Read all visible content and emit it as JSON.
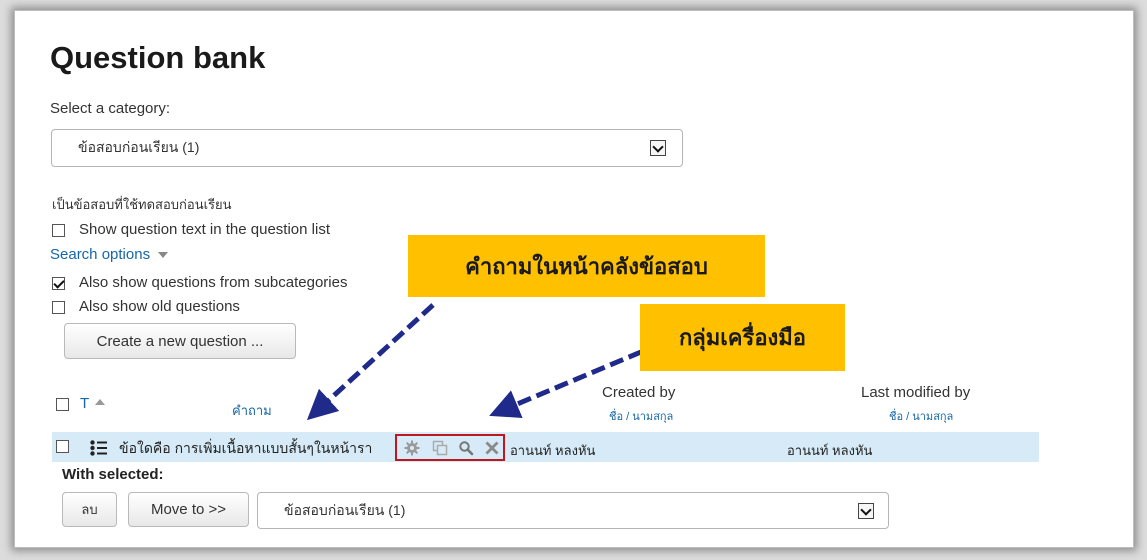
{
  "page": {
    "title": "Question bank",
    "select_category_label": "Select a category:",
    "category_selected": "ข้อสอบก่อนเรียน (1)",
    "category_info": "เป็นข้อสอบที่ใช้ทดสอบก่อนเรียน",
    "show_question_text_label": "Show question text in the question list",
    "search_options_label": "Search options",
    "subcategories_label": "Also show questions from subcategories",
    "old_questions_label": "Also show old questions",
    "create_button": "Create a new question ...",
    "show_question_text_checked": false,
    "subcategories_checked": true,
    "old_questions_checked": false
  },
  "table": {
    "type_header": "T",
    "question_header": "คำถาม",
    "created_by_header": "Created by",
    "created_by_sub": "ชื่อ / นามสกุล",
    "modified_by_header": "Last modified by",
    "modified_by_sub": "ชื่อ / นามสกุล",
    "rows": [
      {
        "question": "ข้อใดคือ การเพิ่มเนื้อหาแบบสั้นๆในหน้ารา",
        "created_by": "อานนท์ หลงหัน",
        "modified_by": "อานนท์ หลงหัน"
      }
    ]
  },
  "bulk": {
    "with_selected_label": "With selected:",
    "delete_button": "ลบ",
    "move_button": "Move to >>",
    "move_target": "ข้อสอบก่อนเรียน (1)"
  },
  "annotations": {
    "callout_question": "คำถามในหน้าคลังข้อสอบ",
    "callout_tools": "กลุ่มเครื่องมือ"
  },
  "colors": {
    "callout": "#ffc000",
    "arrow": "#1f2a8a",
    "highlight_box": "#c0161d",
    "row_bg": "#d6ebf7",
    "link": "#1667a8"
  }
}
